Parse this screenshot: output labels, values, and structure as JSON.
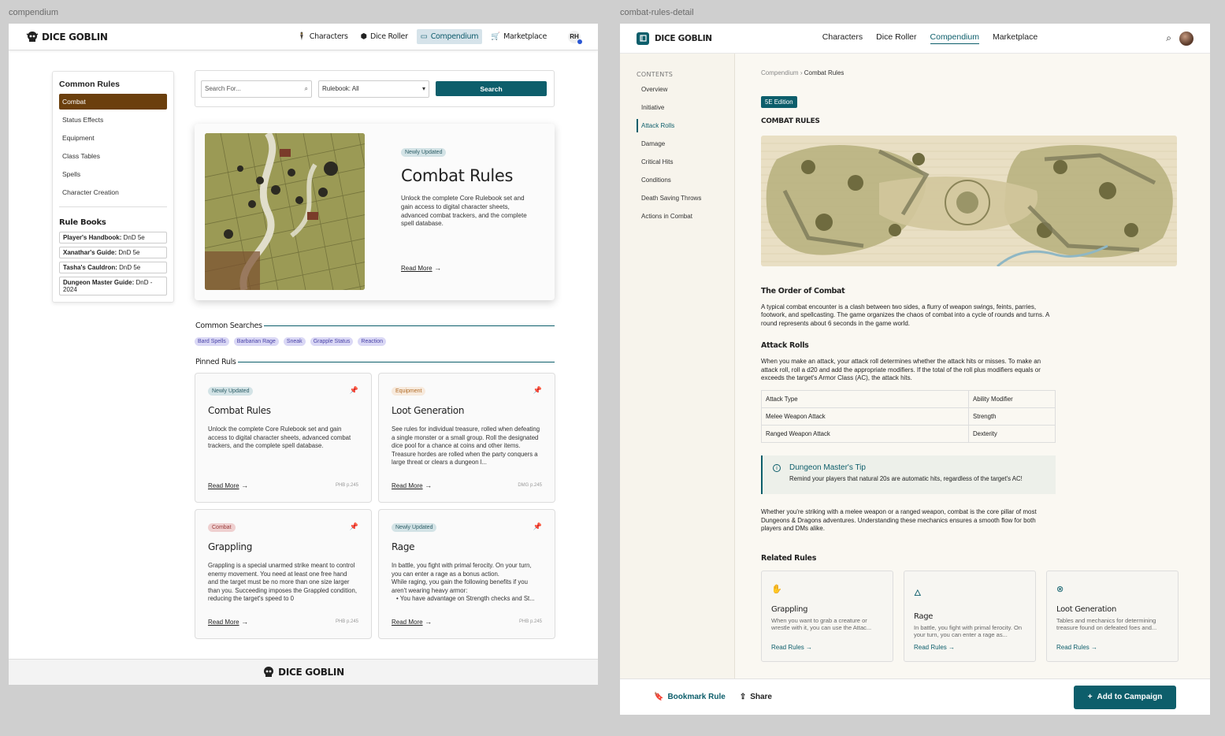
{
  "labels": {
    "compendium": "compendium",
    "detail": "combat-rules-detail"
  },
  "brand": {
    "name": "DICE GOBLIN",
    "name2": "DICE GOBLIN"
  },
  "nav1": {
    "items": [
      "Characters",
      "Dice Roller",
      "Compendium",
      "Marketplace"
    ],
    "active": "Compendium",
    "avatar": "RH"
  },
  "sidebar": {
    "title": "Common Rules",
    "items": [
      "Combat",
      "Status Effects",
      "Equipment",
      "Class Tables",
      "Spells",
      "Character Creation"
    ],
    "rulebooks_title": "Rule Books",
    "rulebooks": [
      {
        "name": "Player's Handbook:",
        "ed": "DnD 5e"
      },
      {
        "name": "Xanathar's Guide:",
        "ed": "DnD 5e"
      },
      {
        "name": "Tasha's Cauldron:",
        "ed": "DnD 5e"
      },
      {
        "name": "Dungeon Master Guide:",
        "ed": "DnD - 2024"
      }
    ]
  },
  "search": {
    "placeholder": "Search For...",
    "select": "Rulebook: All",
    "button": "Search"
  },
  "hero": {
    "badge": "Newly Updated",
    "title": "Combat Rules",
    "desc": "Unlock the complete Core Rulebook set and gain access to digital character sheets, advanced combat trackers, and the complete spell database.",
    "read": "Read More"
  },
  "common_searches": {
    "title": "Common Searches",
    "chips": [
      "Bard Spells",
      "Barbarian Rage",
      "Sneak",
      "Grapple Status",
      "Reaction"
    ]
  },
  "pinned": {
    "title": "Pinned Ruls",
    "cards": [
      {
        "badge": "Newly Updated",
        "title": "Combat Rules",
        "desc": "Unlock the complete Core Rulebook set and gain access to digital character sheets, advanced combat trackers, and the complete spell database.",
        "read": "Read More",
        "ref": "PHB p.245"
      },
      {
        "badge": "Equipment",
        "title": "Loot Generation",
        "desc": "See rules for individual treasure, rolled when defeating a single monster or a small group. Roll the designated dice pool for a chance at coins and other items. Treasure hordes are rolled when the party conquers a large threat or clears a dungeon l...",
        "read": "Read More",
        "ref": "DMG p.245"
      },
      {
        "badge": "Combat",
        "title": "Grappling",
        "desc": "Grappling is a special unarmed strike meant to control enemy movement. You need at least one free hand and the target must be no more than one size larger than you. Succeeding imposes the Grappled condition, reducing the target's speed to 0",
        "read": "Read More",
        "ref": "PHB p.245"
      },
      {
        "badge": "Newly Updated",
        "title": "Rage",
        "desc": "In battle, you fight with primal ferocity. On your turn, you can enter a rage as a bonus action.",
        "desc2": "While raging, you gain the following benefits if you aren't wearing heavy armor:",
        "bullet": "You have advantage on Strength checks and St...",
        "read": "Read More",
        "ref": "PHB p.245"
      }
    ]
  },
  "nav2": {
    "items": [
      "Characters",
      "Dice Roller",
      "Compendium",
      "Marketplace"
    ],
    "active": "Compendium"
  },
  "toc": {
    "title": "CONTENTS",
    "items": [
      "Overview",
      "Initiative",
      "Attack Rolls",
      "Damage",
      "Critical Hits",
      "Conditions",
      "Death Saving Throws",
      "Actions in Combat"
    ],
    "active": "Attack Rolls"
  },
  "detail": {
    "crumb_root": "Compendium",
    "crumb_current": "Combat Rules",
    "edition": "5E Edition",
    "title": "COMBAT RULES",
    "order_title": "The Order of Combat",
    "order_text": "A typical combat encounter is a clash between two sides, a flurry of weapon swings, feints, parries, footwork, and spellcasting. The game organizes the chaos of combat into a cycle of rounds and turns. A round represents about 6 seconds in the game world.",
    "attack_title": "Attack Rolls",
    "attack_text": "When you make an attack, your attack roll determines whether the attack hits or misses. To make an attack roll, roll a d20 and add the appropriate modifiers. If the total of the roll plus modifiers equals or exceeds the target's Armor Class (AC), the attack hits.",
    "table": [
      [
        "Attack Type",
        "Ability Modifier"
      ],
      [
        "Melee Weapon Attack",
        "Strength"
      ],
      [
        "Ranged Weapon Attack",
        "Dexterity"
      ]
    ],
    "tip_title": "Dungeon Master's Tip",
    "tip_text": "Remind your players that natural 20s are automatic hits, regardless of the target's AC!",
    "outro": "Whether you're striking with a melee weapon or a ranged weapon, combat is the core pillar of most Dungeons & Dragons adventures. Understanding these mechanics ensures a smooth flow for both players and DMs alike.",
    "related_title": "Related Rules",
    "related": [
      {
        "title": "Grappling",
        "desc": "When you want to grab a creature or wrestle with it, you can use the Attac...",
        "link": "Read Rules"
      },
      {
        "title": "Rage",
        "desc": "In battle, you fight with primal ferocity. On your turn, you can enter a rage as...",
        "link": "Read Rules"
      },
      {
        "title": "Loot Generation",
        "desc": "Tables and mechanics for determining treasure found on defeated foes and...",
        "link": "Read Rules"
      }
    ]
  },
  "actions": {
    "bookmark": "Bookmark Rule",
    "share": "Share",
    "add": "Add to Campaign"
  },
  "colors": {
    "teal": "#0d5e6b",
    "brown": "#6b3f0d",
    "parchment": "#faf8f2"
  }
}
